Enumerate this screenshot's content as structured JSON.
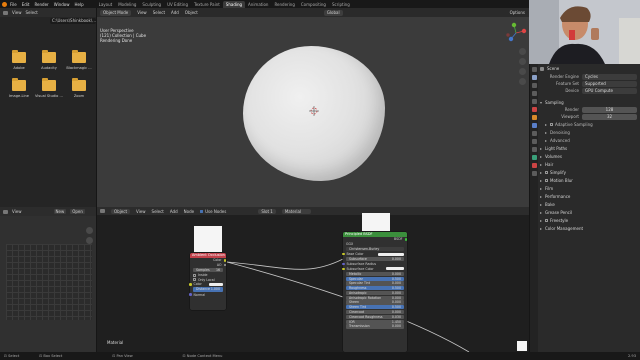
{
  "topbar": {
    "menu": [
      "File",
      "Edit",
      "Render",
      "Window",
      "Help"
    ],
    "workspaces": [
      "Layout",
      "Modeling",
      "Sculpting",
      "UV Editing",
      "Texture Paint",
      "Shading",
      "Animation",
      "Rendering",
      "Compositing",
      "Scripting"
    ],
    "active_workspace": "Shading",
    "scene": "Scene"
  },
  "file_browser": {
    "view_label": "View",
    "select_label": "Select",
    "path": "C:\\Users\\Shinkbook\\...",
    "items": [
      "Adobe",
      "Audacity",
      "Blackmagic ...",
      "Image-Line",
      "Visual Studio ...",
      "Zoom"
    ]
  },
  "viewport": {
    "mode": "Object Mode",
    "menus": [
      "View",
      "Select",
      "Add",
      "Object"
    ],
    "orientation": "Global",
    "options": "Options",
    "info_lines": [
      "User Perspective",
      "(121) Collection | Cube",
      "Rendering Done"
    ]
  },
  "properties": {
    "scene_label": "Scene",
    "render_engine_label": "Render Engine",
    "render_engine": "Cycles",
    "feature_set_label": "Feature Set",
    "feature_set": "Supported",
    "device_label": "Device",
    "device": "GPU Compute",
    "sampling": "Sampling",
    "render_label": "Render",
    "render_samples": "128",
    "viewport_label": "Viewport",
    "viewport_samples": "32",
    "adaptive": "Adaptive Sampling",
    "denoising": "Denoising",
    "advanced": "Advanced",
    "sections": [
      "Light Paths",
      "Volumes",
      "Hair",
      "Simplify",
      "Motion Blur",
      "Film",
      "Performance",
      "Bake",
      "Grease Pencil",
      "Freestyle",
      "Color Management"
    ]
  },
  "image_editor": {
    "view_label": "View",
    "new_label": "New",
    "open_label": "Open"
  },
  "node_editor": {
    "editor_type": "Object",
    "menus": [
      "View",
      "Select",
      "Add",
      "Node"
    ],
    "use_nodes": "Use Nodes",
    "slot": "Slot 1",
    "material": "Material",
    "footer_label": "Material",
    "ao_node": {
      "title": "Ambient Occlusion",
      "outputs": [
        "Color",
        "AO"
      ],
      "samples_label": "Samples",
      "samples": "16",
      "inside": "Inside",
      "only_local": "Only Local",
      "color": "Color",
      "distance_label": "Distance",
      "distance": "1.000",
      "normal": "Normal"
    },
    "bsdf_node": {
      "title": "Principled BSDF",
      "output": "BSDF",
      "distribution": "GGX",
      "subsurface_method": "Christensen-Burley",
      "rows": [
        {
          "label": "Base Color",
          "value": ""
        },
        {
          "label": "Subsurface",
          "value": "0.000"
        },
        {
          "label": "Subsurface Radius",
          "value": ""
        },
        {
          "label": "Subsurface Color",
          "value": ""
        },
        {
          "label": "Metallic",
          "value": "0.000"
        },
        {
          "label": "Specular",
          "value": "0.500"
        },
        {
          "label": "Specular Tint",
          "value": "0.000"
        },
        {
          "label": "Roughness",
          "value": "0.500"
        },
        {
          "label": "Anisotropic",
          "value": "0.000"
        },
        {
          "label": "Anisotropic Rotation",
          "value": "0.000"
        },
        {
          "label": "Sheen",
          "value": "0.000"
        },
        {
          "label": "Sheen Tint",
          "value": "0.500"
        },
        {
          "label": "Clearcoat",
          "value": "0.000"
        },
        {
          "label": "Clearcoat Roughness",
          "value": "0.030"
        },
        {
          "label": "IOR",
          "value": "1.450"
        },
        {
          "label": "Transmission",
          "value": "0.000"
        }
      ]
    }
  },
  "statusbar": {
    "items": [
      "Select",
      "Box Select",
      "Pan View",
      "Node Context Menu"
    ],
    "version": "2.93"
  },
  "colors": {
    "accent": "#4772b3",
    "ao_header": "#c2414b",
    "bsdf_header": "#3b8f3c",
    "folder": "#e7b044"
  }
}
